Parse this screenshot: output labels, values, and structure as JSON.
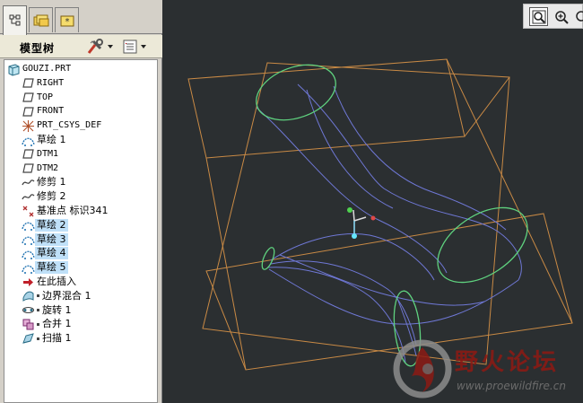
{
  "tree_panel": {
    "title": "模型树",
    "items": [
      {
        "icon": "part-icon",
        "label": "GOUZI.PRT",
        "mono": true,
        "indent": 0,
        "selected": false
      },
      {
        "icon": "datum-plane-icon",
        "label": "RIGHT",
        "mono": true,
        "indent": 1,
        "selected": false
      },
      {
        "icon": "datum-plane-icon",
        "label": "TOP",
        "mono": true,
        "indent": 1,
        "selected": false
      },
      {
        "icon": "datum-plane-icon",
        "label": "FRONT",
        "mono": true,
        "indent": 1,
        "selected": false
      },
      {
        "icon": "csys-icon",
        "label": "PRT_CSYS_DEF",
        "mono": true,
        "indent": 1,
        "selected": false
      },
      {
        "icon": "sketch-icon",
        "label": "草绘 1",
        "mono": false,
        "indent": 1,
        "selected": false
      },
      {
        "icon": "datum-plane-icon",
        "label": "DTM1",
        "mono": true,
        "indent": 1,
        "selected": false
      },
      {
        "icon": "datum-plane-icon",
        "label": "DTM2",
        "mono": true,
        "indent": 1,
        "selected": false
      },
      {
        "icon": "trim-icon",
        "label": "修剪 1",
        "mono": false,
        "indent": 1,
        "selected": false
      },
      {
        "icon": "trim-icon",
        "label": "修剪 2",
        "mono": false,
        "indent": 1,
        "selected": false
      },
      {
        "icon": "datum-point-icon",
        "label": "基准点 标识341",
        "mono": false,
        "indent": 1,
        "selected": false
      },
      {
        "icon": "sketch-icon",
        "label": "草绘 2",
        "mono": false,
        "indent": 1,
        "selected": true
      },
      {
        "icon": "sketch-icon",
        "label": "草绘 3",
        "mono": false,
        "indent": 1,
        "selected": true
      },
      {
        "icon": "sketch-icon",
        "label": "草绘 4",
        "mono": false,
        "indent": 1,
        "selected": true
      },
      {
        "icon": "sketch-icon",
        "label": "草绘 5",
        "mono": false,
        "indent": 1,
        "selected": true
      },
      {
        "icon": "insert-here-icon",
        "label": "在此插入",
        "mono": false,
        "indent": 1,
        "selected": false
      },
      {
        "icon": "boundary-blend-icon",
        "label": "边界混合 1",
        "mono": false,
        "indent": 1,
        "selected": false,
        "dot": true
      },
      {
        "icon": "revolve-icon",
        "label": "旋转 1",
        "mono": false,
        "indent": 1,
        "selected": false,
        "dot": true
      },
      {
        "icon": "merge-icon",
        "label": "合并 1",
        "mono": false,
        "indent": 1,
        "selected": false,
        "dot": true
      },
      {
        "icon": "sweep-icon",
        "label": "扫描 1",
        "mono": false,
        "indent": 1,
        "selected": false,
        "dot": true
      }
    ]
  },
  "watermark": {
    "title": "野火论坛",
    "url": "www.proewildfire.cn"
  },
  "colors": {
    "viewport_bg": "#2b2f31",
    "datum_plane": "#c98a45",
    "surface_edge": "#6f78d6",
    "sketch_green": "#5fd27f",
    "selection_bg": "#bfe0f8"
  }
}
